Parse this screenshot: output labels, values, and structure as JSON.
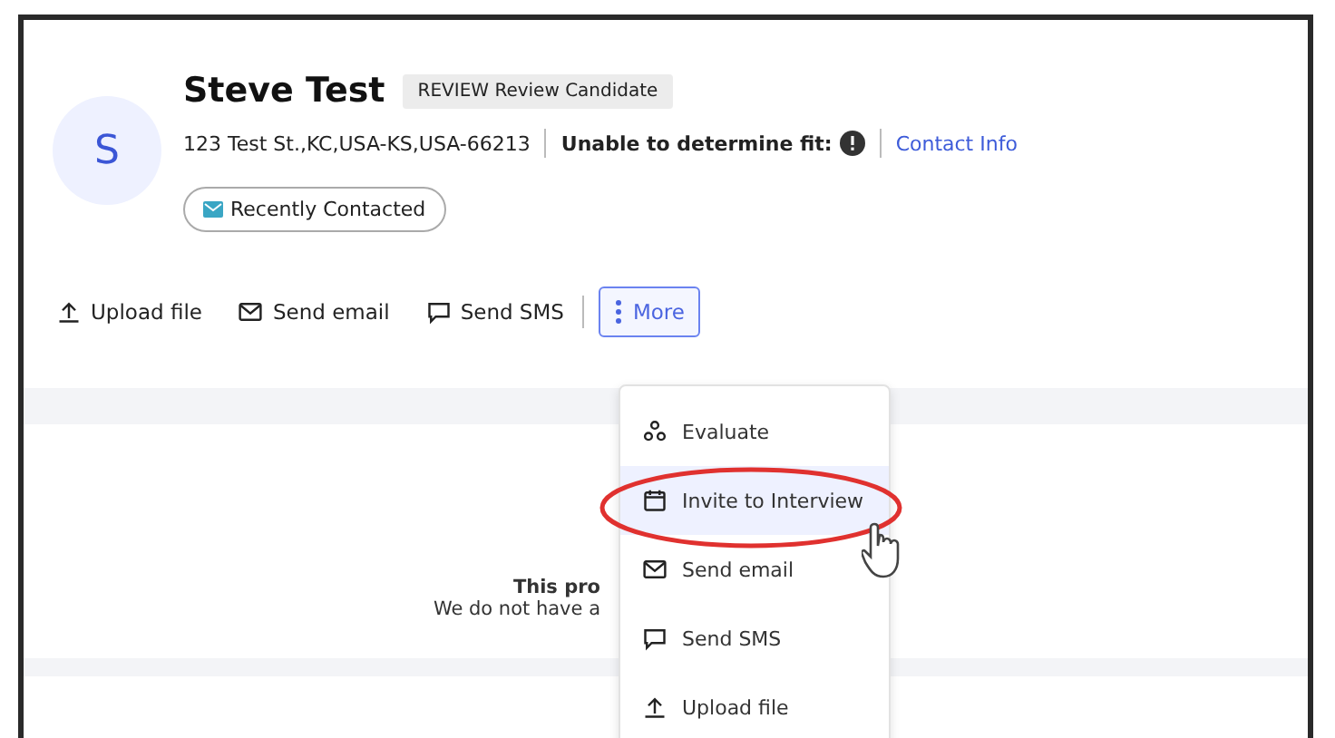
{
  "candidate": {
    "initial": "S",
    "name": "Steve Test",
    "status_badge": "REVIEW Review Candidate",
    "address": "123 Test St.,KC,USA-KS,USA-66213",
    "fit": "Unable to determine fit:",
    "contact_link": "Contact Info",
    "tag": "Recently Contacted"
  },
  "actions": [
    {
      "kind": "upload",
      "label": "Upload file"
    },
    {
      "kind": "email",
      "label": "Send email"
    },
    {
      "kind": "sms",
      "label": "Send SMS"
    }
  ],
  "more_button": {
    "label": "More",
    "open": true
  },
  "menu": [
    {
      "kind": "evaluate",
      "label": "Evaluate",
      "selected": false
    },
    {
      "kind": "calendar",
      "label": "Invite to Interview",
      "selected": true
    },
    {
      "kind": "email",
      "label": "Send email",
      "selected": false
    },
    {
      "kind": "sms",
      "label": "Send SMS",
      "selected": false
    },
    {
      "kind": "upload",
      "label": "Upload file",
      "selected": false
    }
  ],
  "empty_state": {
    "title": "This pro",
    "message": "We do not have a"
  }
}
